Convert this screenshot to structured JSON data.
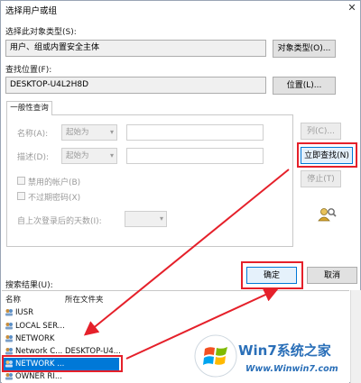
{
  "window": {
    "title": "选择用户或组"
  },
  "object_type": {
    "label": "选择此对象类型(S):",
    "value": "用户、组或内置安全主体",
    "button": "对象类型(O)..."
  },
  "location": {
    "label": "查找位置(F):",
    "value": "DESKTOP-U4L2H8D",
    "button": "位置(L)..."
  },
  "general_query": {
    "tab": "一般性查询",
    "name_label": "名称(A):",
    "name_combo": "起始为",
    "desc_label": "描述(D):",
    "desc_combo": "起始为",
    "disabled_accounts": "禁用的帐户(B)",
    "no_expire_password": "不过期密码(X)",
    "days_since_login": "自上次登录后的天数(I):"
  },
  "buttons": {
    "columns": "列(C)...",
    "find_now": "立即查找(N)",
    "stop": "停止(T)",
    "ok": "确定",
    "cancel": "取消"
  },
  "results": {
    "label": "搜索结果(U):",
    "columns": [
      "名称",
      "所在文件夹"
    ],
    "rows": [
      {
        "name": "IUSR",
        "folder": ""
      },
      {
        "name": "LOCAL SER...",
        "folder": ""
      },
      {
        "name": "NETWORK",
        "folder": ""
      },
      {
        "name": "Network C...",
        "folder": "DESKTOP-U4..."
      },
      {
        "name": "NETWORK ...",
        "folder": ""
      },
      {
        "name": "OWNER RI...",
        "folder": ""
      }
    ]
  },
  "watermark": {
    "brand": "Win7系统之家",
    "url": "Www.Winwin7.com"
  },
  "colors": {
    "highlight": "#e5202a",
    "selection": "#0078d7"
  }
}
